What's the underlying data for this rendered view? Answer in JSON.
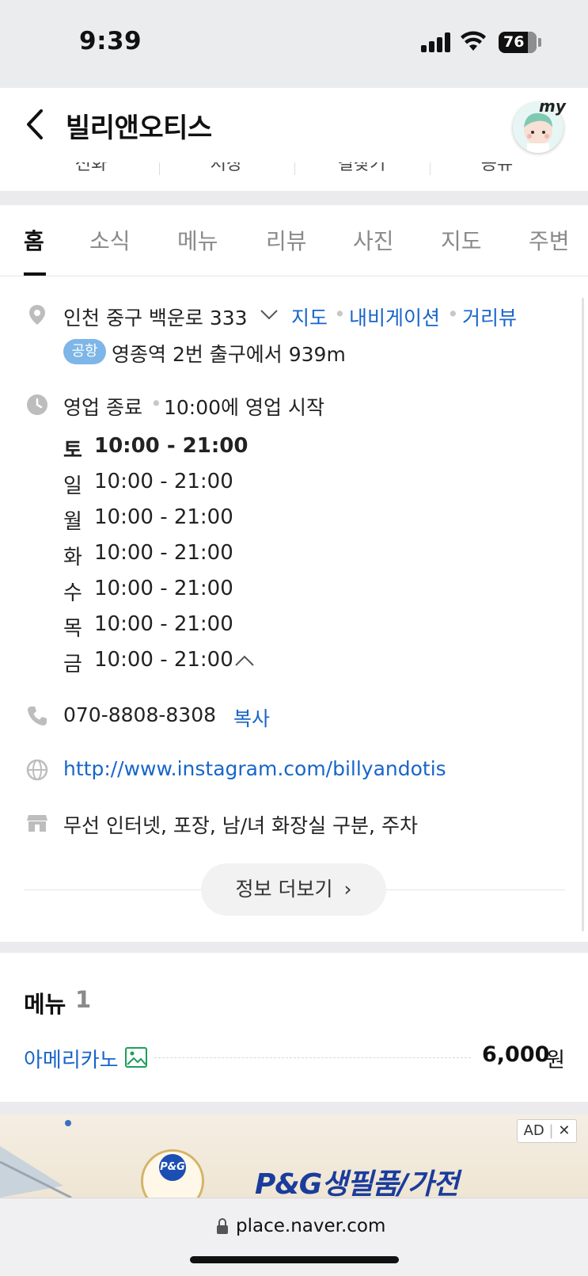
{
  "status": {
    "time": "9:39",
    "battery": "76"
  },
  "header": {
    "title": "빌리앤오티스",
    "my_label": "my"
  },
  "actions": [
    "전화",
    "저장",
    "길찾기",
    "공유"
  ],
  "tabs": [
    "홈",
    "소식",
    "메뉴",
    "리뷰",
    "사진",
    "지도",
    "주변"
  ],
  "info": {
    "address": "인천 중구 백운로 333",
    "address_links": [
      "지도",
      "내비게이션",
      "거리뷰"
    ],
    "badge": "공항",
    "subway": "영종역 2번 출구에서 939m",
    "hours_status": "영업 종료",
    "hours_next": "10:00에 영업 시작",
    "hours": [
      {
        "day": "토",
        "time": "10:00 - 21:00"
      },
      {
        "day": "일",
        "time": "10:00 - 21:00"
      },
      {
        "day": "월",
        "time": "10:00 - 21:00"
      },
      {
        "day": "화",
        "time": "10:00 - 21:00"
      },
      {
        "day": "수",
        "time": "10:00 - 21:00"
      },
      {
        "day": "목",
        "time": "10:00 - 21:00"
      },
      {
        "day": "금",
        "time": "10:00 - 21:00"
      }
    ],
    "phone": "070-8808-8308",
    "copy_label": "복사",
    "website": "http://www.instagram.com/billyandotis",
    "amenities": "무선 인터넷, 포장, 남/녀 화장실 구분, 주차",
    "more_label": "정보 더보기"
  },
  "menu": {
    "title": "메뉴",
    "count": "1",
    "items": [
      {
        "name": "아메리카노",
        "price": "6,000",
        "unit": "원"
      }
    ]
  },
  "ad": {
    "tag": "AD",
    "close": "✕",
    "brand": "P&G",
    "text": "P&G생필품/가전"
  },
  "browser": {
    "url": "place.naver.com"
  },
  "colors": {
    "link": "#1865c9",
    "badge": "#7db6e7"
  }
}
